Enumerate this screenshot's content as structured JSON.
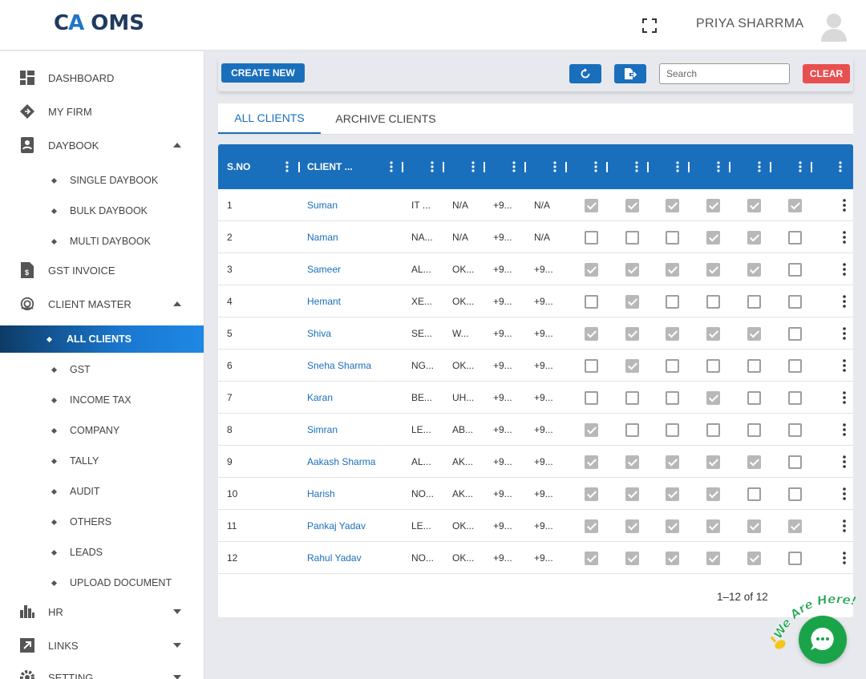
{
  "header": {
    "logo_ca_left": "C",
    "logo_ca_right": "A",
    "logo_text": "OMS",
    "user_name": "PRIYA SHARRMA"
  },
  "sidebar": {
    "items": [
      {
        "label": "DASHBOARD",
        "icon": "dashboard-icon"
      },
      {
        "label": "MY FIRM",
        "icon": "firm-icon"
      },
      {
        "label": "DAYBOOK",
        "icon": "daybook-icon",
        "expanded": true,
        "children": [
          "SINGLE DAYBOOK",
          "BULK DAYBOOK",
          "MULTI DAYBOOK"
        ]
      },
      {
        "label": "GST INVOICE",
        "icon": "invoice-icon"
      },
      {
        "label": "CLIENT MASTER",
        "icon": "client-master-icon",
        "expanded": true,
        "children": [
          "ALL CLIENTS",
          "GST",
          "INCOME TAX",
          "COMPANY",
          "TALLY",
          "AUDIT",
          "OTHERS",
          "LEADS",
          "UPLOAD DOCUMENT"
        ]
      },
      {
        "label": "HR",
        "icon": "bar-chart-icon"
      },
      {
        "label": "LINKS",
        "icon": "arrow-link-icon"
      },
      {
        "label": "SETTING",
        "icon": "gear-icon"
      }
    ],
    "active_child": "ALL CLIENTS"
  },
  "toolbar": {
    "create_label": "CREATE NEW",
    "search_placeholder": "Search",
    "clear_label": "CLEAR"
  },
  "tabs": [
    {
      "label": "ALL CLIENTS",
      "active": true
    },
    {
      "label": "ARCHIVE CLIENTS",
      "active": false
    }
  ],
  "table": {
    "headers": [
      "S.NO",
      "CLIENT ..."
    ],
    "rows": [
      {
        "sno": "1",
        "name": "Suman",
        "c3": "IT ...",
        "c4": "N/A",
        "c5": "+9...",
        "c6": "N/A",
        "checks": [
          true,
          true,
          true,
          true,
          true,
          true
        ]
      },
      {
        "sno": "2",
        "name": "Naman",
        "c3": "NA...",
        "c4": "N/A",
        "c5": "+9...",
        "c6": "N/A",
        "checks": [
          false,
          false,
          false,
          true,
          true,
          false
        ]
      },
      {
        "sno": "3",
        "name": "Sameer",
        "c3": "AL...",
        "c4": "OK...",
        "c5": "+9...",
        "c6": "+9...",
        "checks": [
          true,
          true,
          true,
          true,
          true,
          false
        ]
      },
      {
        "sno": "4",
        "name": "Hemant",
        "c3": "XE...",
        "c4": "OK...",
        "c5": "+9...",
        "c6": "+9...",
        "checks": [
          false,
          true,
          false,
          false,
          false,
          false
        ]
      },
      {
        "sno": "5",
        "name": "Shiva",
        "c3": "SE...",
        "c4": "W...",
        "c5": "+9...",
        "c6": "+9...",
        "checks": [
          true,
          true,
          true,
          true,
          true,
          false
        ]
      },
      {
        "sno": "6",
        "name": "Sneha Sharma",
        "c3": "NG...",
        "c4": "OK...",
        "c5": "+9...",
        "c6": "+9...",
        "checks": [
          false,
          true,
          false,
          false,
          false,
          false
        ]
      },
      {
        "sno": "7",
        "name": "Karan",
        "c3": "BE...",
        "c4": "UH...",
        "c5": "+9...",
        "c6": "+9...",
        "checks": [
          false,
          false,
          false,
          true,
          false,
          false
        ]
      },
      {
        "sno": "8",
        "name": "Simran",
        "c3": "LE...",
        "c4": "AB...",
        "c5": "+9...",
        "c6": "+9...",
        "checks": [
          true,
          false,
          false,
          false,
          false,
          false
        ]
      },
      {
        "sno": "9",
        "name": "Aakash Sharma",
        "c3": "AL...",
        "c4": "AK...",
        "c5": "+9...",
        "c6": "+9...",
        "checks": [
          true,
          true,
          true,
          true,
          true,
          false
        ]
      },
      {
        "sno": "10",
        "name": "Harish",
        "c3": "NO...",
        "c4": "AK...",
        "c5": "+9...",
        "c6": "+9...",
        "checks": [
          true,
          true,
          true,
          true,
          false,
          false
        ]
      },
      {
        "sno": "11",
        "name": "Pankaj Yadav",
        "c3": "LE...",
        "c4": "OK...",
        "c5": "+9...",
        "c6": "+9...",
        "checks": [
          true,
          true,
          true,
          true,
          true,
          true
        ]
      },
      {
        "sno": "12",
        "name": "Rahul Yadav",
        "c3": "NO...",
        "c4": "OK...",
        "c5": "+9...",
        "c6": "+9...",
        "checks": [
          true,
          true,
          true,
          true,
          true,
          false
        ]
      }
    ],
    "pagination": "1–12 of 12"
  },
  "chat": {
    "badge_text": "We Are Here!",
    "icon": "chat-icon",
    "brand_color": "#1aa44a"
  },
  "colors": {
    "primary": "#1a6fbd",
    "danger": "#e8504f",
    "checked": "#b8b8b8"
  }
}
